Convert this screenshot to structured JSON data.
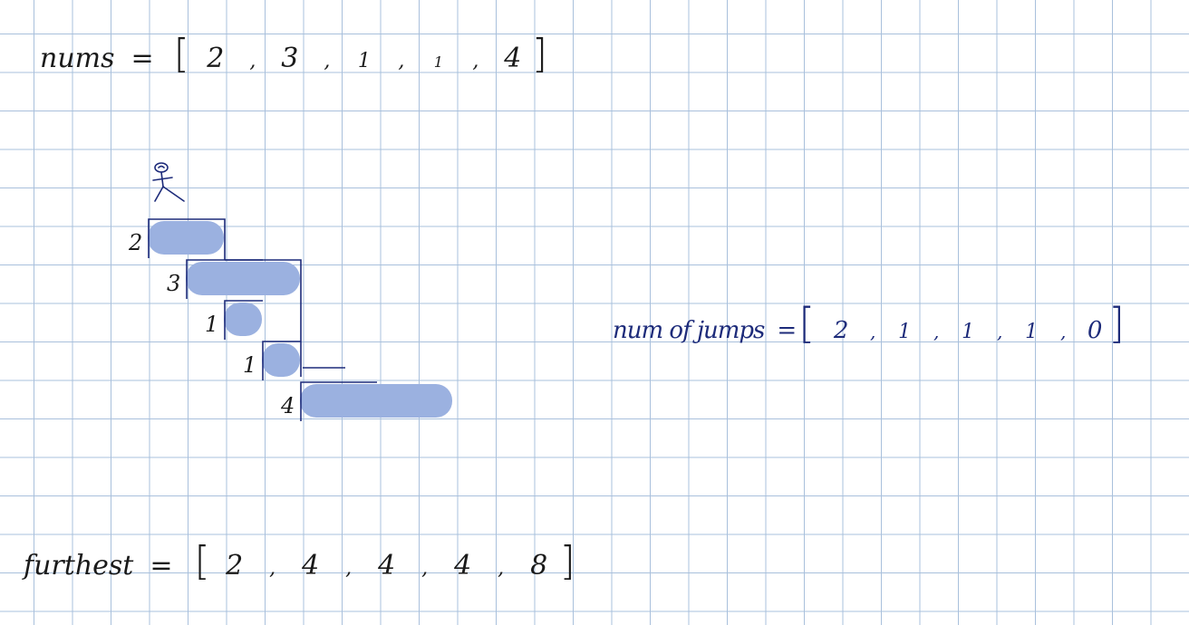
{
  "nums": {
    "label": "nums",
    "equals": "=",
    "open": "[",
    "close": "]",
    "sep": ",",
    "values": [
      "2",
      "3",
      "1",
      "1",
      "4"
    ]
  },
  "num_of_jumps": {
    "label": "num of jumps",
    "equals": "=",
    "open": "[",
    "close": "]",
    "sep": ",",
    "values": [
      "2",
      "1",
      "1",
      "1",
      "0"
    ]
  },
  "furthest": {
    "label": "furthest",
    "equals": "=",
    "open": "[",
    "close": "]",
    "sep": ",",
    "values": [
      "2",
      "4",
      "4",
      "4",
      "8"
    ]
  },
  "steps": [
    {
      "label": "2",
      "jump": 2
    },
    {
      "label": "3",
      "jump": 3
    },
    {
      "label": "1",
      "jump": 1
    },
    {
      "label": "1",
      "jump": 1
    },
    {
      "label": "4",
      "jump": 4
    }
  ],
  "colors": {
    "grid": "#a9c0dc",
    "ink_black": "#1a1a1a",
    "ink_navy": "#1d2b7a",
    "highlight": "#9bb1e0"
  },
  "icons": {
    "figure": "stick-figure-icon"
  }
}
